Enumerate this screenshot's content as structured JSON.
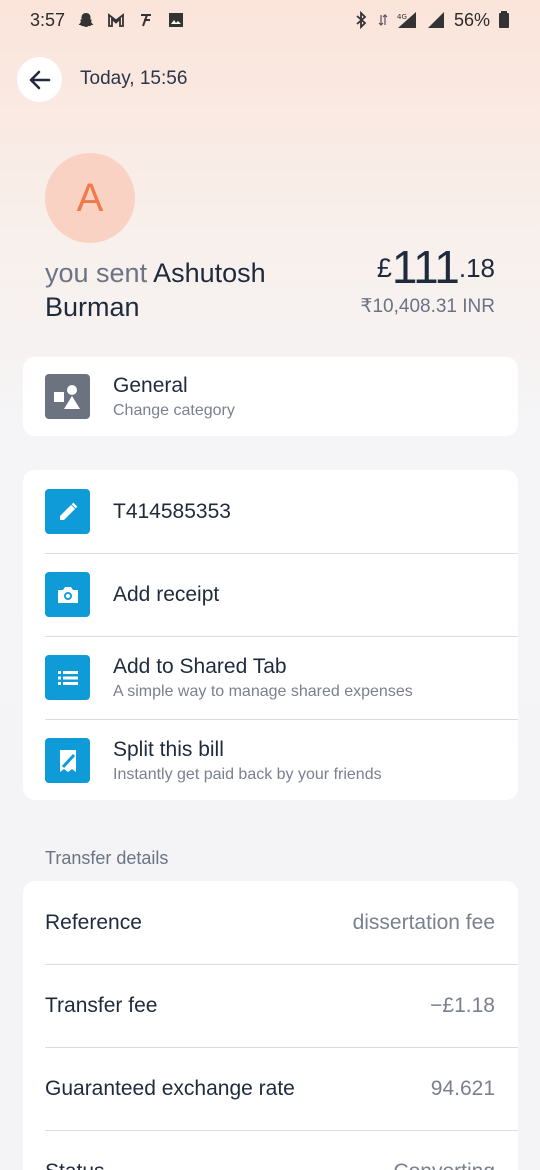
{
  "status_bar": {
    "time": "3:57",
    "battery": "56%",
    "network": "4G",
    "left_icons": [
      "snapchat-icon",
      "gmail-icon",
      "app-icon",
      "gallery-icon"
    ],
    "right_icons": [
      "bluetooth-icon",
      "data-icon",
      "signal-icon",
      "signal-icon",
      "battery-icon"
    ]
  },
  "header": {
    "time": "Today, 15:56"
  },
  "recipient": {
    "initial": "A",
    "prefix": "you sent",
    "name": "Ashutosh Burman",
    "name_first": "Ashutosh",
    "name_last": "Burman"
  },
  "amount": {
    "currency_symbol": "£",
    "major": "111",
    "minor": ".18",
    "converted": "₹10,408.31 INR"
  },
  "category": {
    "title": "General",
    "subtitle": "Change category",
    "icon": "category-shapes-icon"
  },
  "actions": [
    {
      "title": "T414585353",
      "subtitle": "",
      "icon": "pencil-icon"
    },
    {
      "title": "Add receipt",
      "subtitle": "",
      "icon": "camera-icon"
    },
    {
      "title": "Add to Shared Tab",
      "subtitle": "A simple way to manage shared expenses",
      "icon": "list-icon"
    },
    {
      "title": "Split this bill",
      "subtitle": "Instantly get paid back by your friends",
      "icon": "receipt-split-icon"
    }
  ],
  "transfer_details": {
    "label": "Transfer details",
    "rows": [
      {
        "label": "Reference",
        "value": "dissertation fee"
      },
      {
        "label": "Transfer fee",
        "value": "−£1.18"
      },
      {
        "label": "Guaranteed exchange rate",
        "value": "94.621"
      },
      {
        "label": "Status",
        "value": "Converting"
      }
    ]
  },
  "colors": {
    "accent_blue": "#0e9bd8",
    "avatar_bg": "#f9d2c4",
    "avatar_text": "#ef7a4b",
    "category_icon_bg": "#6b7280"
  }
}
